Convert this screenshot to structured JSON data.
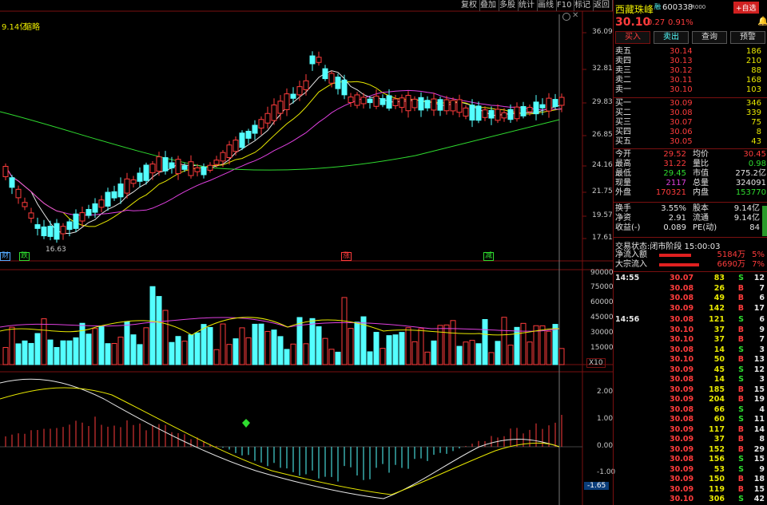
{
  "toolbar": {
    "items": [
      "复权",
      "叠加",
      "多股",
      "统计",
      "画线",
      "F10",
      "标记",
      "返回"
    ]
  },
  "main_panel": {
    "legend_value": "9.14亿",
    "legend_mode": "缩略",
    "price_ticks": [
      "36.09",
      "32.81",
      "29.83",
      "26.85",
      "24.16",
      "21.75",
      "19.57",
      "17.61"
    ],
    "low_marker": "16.63",
    "badges": [
      {
        "text": "跌",
        "color": "#2fdc2f"
      },
      {
        "text": "涨",
        "color": "#ff3c3c"
      },
      {
        "text": "减",
        "color": "#2fdc2f"
      },
      {
        "text": "财",
        "color": "#54aaff"
      }
    ]
  },
  "volume_panel": {
    "ticks": [
      "90000",
      "75000",
      "60000",
      "45000",
      "30000",
      "15000"
    ],
    "scale_label": "X10"
  },
  "macd_panel": {
    "ticks": [
      "2.00",
      "1.00",
      "0.00",
      "-1.00"
    ],
    "current_value": "-1.65"
  },
  "colors": {
    "up": "#ff3c3c",
    "down": "#54ffff",
    "ma5": "#e6e6e6",
    "ma10": "#e8e800",
    "ma20": "#e040e0",
    "ma60": "#2fdc2f",
    "border": "#7a1010"
  },
  "quote": {
    "name": "西藏珠峰",
    "badge": "融",
    "code": "600338",
    "flag": "R000",
    "add_label": "+自选",
    "price": "30.10",
    "change": "0.27",
    "change_pct": "0.91%",
    "buttons": [
      "买入",
      "卖出",
      "查询",
      "预警"
    ],
    "asks": [
      {
        "label": "卖五",
        "price": "30.14",
        "vol": "186"
      },
      {
        "label": "卖四",
        "price": "30.13",
        "vol": "210"
      },
      {
        "label": "卖三",
        "price": "30.12",
        "vol": "88"
      },
      {
        "label": "卖二",
        "price": "30.11",
        "vol": "168"
      },
      {
        "label": "卖一",
        "price": "30.10",
        "vol": "103"
      }
    ],
    "bids": [
      {
        "label": "买一",
        "price": "30.09",
        "vol": "346"
      },
      {
        "label": "买二",
        "price": "30.08",
        "vol": "339"
      },
      {
        "label": "买三",
        "price": "30.07",
        "vol": "75"
      },
      {
        "label": "买四",
        "price": "30.06",
        "vol": "8"
      },
      {
        "label": "买五",
        "price": "30.05",
        "vol": "43"
      }
    ],
    "stats": [
      {
        "l1": "今开",
        "v1": "29.52",
        "c1": "red",
        "l2": "均价",
        "v2": "30.45",
        "c2": "red"
      },
      {
        "l1": "最高",
        "v1": "31.22",
        "c1": "red",
        "l2": "量比",
        "v2": "0.98",
        "c2": "green"
      },
      {
        "l1": "最低",
        "v1": "29.45",
        "c1": "green",
        "l2": "市值",
        "v2": "275.2亿",
        "c2": "white"
      },
      {
        "l1": "现量",
        "v1": "2117",
        "c1": "purple",
        "l2": "总量",
        "v2": "324091",
        "c2": "white"
      },
      {
        "l1": "外盘",
        "v1": "170321",
        "c1": "red",
        "l2": "内盘",
        "v2": "153770",
        "c2": "green"
      }
    ],
    "stats2": [
      {
        "l1": "换手",
        "v1": "3.55%",
        "l2": "股本",
        "v2": "9.14亿"
      },
      {
        "l1": "净资",
        "v1": "2.91",
        "l2": "流通",
        "v2": "9.14亿"
      },
      {
        "l1": "收益(-)",
        "v1": "0.089",
        "l2": "PE(动)",
        "v2": "84"
      }
    ],
    "status": "交易状态:闭市阶段 15:00:03",
    "flows": [
      {
        "label": "净流入额",
        "value": "5184万",
        "pct": "5%"
      },
      {
        "label": "大宗流入",
        "value": "6690万",
        "pct": "7%"
      }
    ]
  },
  "ticks": [
    {
      "time": "14:55",
      "price": "30.07",
      "vol": "83",
      "side": "S",
      "n": "12"
    },
    {
      "time": "",
      "price": "30.08",
      "vol": "26",
      "side": "B",
      "n": "7"
    },
    {
      "time": "",
      "price": "30.08",
      "vol": "49",
      "side": "B",
      "n": "6"
    },
    {
      "time": "",
      "price": "30.09",
      "vol": "142",
      "side": "B",
      "n": "17"
    },
    {
      "time": "14:56",
      "price": "30.08",
      "vol": "121",
      "side": "S",
      "n": "6"
    },
    {
      "time": "",
      "price": "30.10",
      "vol": "37",
      "side": "B",
      "n": "9"
    },
    {
      "time": "",
      "price": "30.10",
      "vol": "37",
      "side": "B",
      "n": "7"
    },
    {
      "time": "",
      "price": "30.08",
      "vol": "14",
      "side": "S",
      "n": "3"
    },
    {
      "time": "",
      "price": "30.10",
      "vol": "50",
      "side": "B",
      "n": "13"
    },
    {
      "time": "",
      "price": "30.09",
      "vol": "45",
      "side": "S",
      "n": "12"
    },
    {
      "time": "",
      "price": "30.08",
      "vol": "14",
      "side": "S",
      "n": "3"
    },
    {
      "time": "",
      "price": "30.09",
      "vol": "185",
      "side": "B",
      "n": "15"
    },
    {
      "time": "",
      "price": "30.09",
      "vol": "204",
      "side": "B",
      "n": "19"
    },
    {
      "time": "",
      "price": "30.08",
      "vol": "66",
      "side": "S",
      "n": "4"
    },
    {
      "time": "",
      "price": "30.08",
      "vol": "60",
      "side": "S",
      "n": "11"
    },
    {
      "time": "",
      "price": "30.09",
      "vol": "117",
      "side": "B",
      "n": "14"
    },
    {
      "time": "",
      "price": "30.09",
      "vol": "37",
      "side": "B",
      "n": "8"
    },
    {
      "time": "",
      "price": "30.09",
      "vol": "152",
      "side": "B",
      "n": "29"
    },
    {
      "time": "",
      "price": "30.08",
      "vol": "156",
      "side": "S",
      "n": "15"
    },
    {
      "time": "",
      "price": "30.09",
      "vol": "53",
      "side": "S",
      "n": "9"
    },
    {
      "time": "",
      "price": "30.09",
      "vol": "150",
      "side": "B",
      "n": "18"
    },
    {
      "time": "",
      "price": "30.09",
      "vol": "119",
      "side": "B",
      "n": "15"
    },
    {
      "time": "",
      "price": "30.10",
      "vol": "306",
      "side": "S",
      "n": "42"
    }
  ]
}
